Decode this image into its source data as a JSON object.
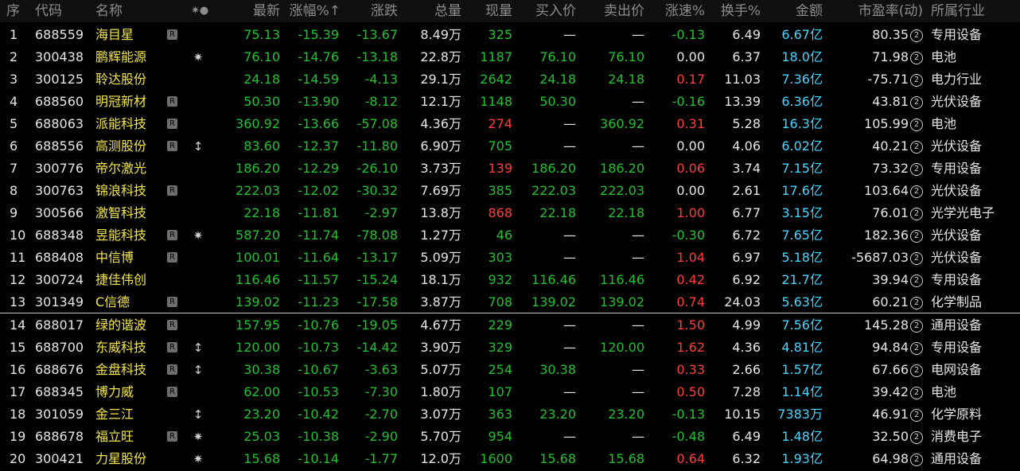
{
  "header": {
    "seq": "序",
    "code": "代码",
    "name": "名称",
    "icons": "✷●",
    "latest": "最新",
    "chg_pct": "涨幅%↑",
    "chg": "涨跌",
    "volume": "总量",
    "cur_vol": "现量",
    "bid": "买入价",
    "ask": "卖出价",
    "speed": "涨速%",
    "turnover": "换手%",
    "amount": "金额",
    "pe": "市盈率(动)",
    "industry": "所属行业"
  },
  "colors": {
    "up": "#ff3b3b",
    "down": "#20c030",
    "flat": "#e6e6e6",
    "name": "#f2e64a",
    "amount": "#45d6ff"
  },
  "rows": [
    {
      "seq": "1",
      "code": "688559",
      "name": "海目星",
      "badge": "R",
      "icon": "",
      "latest": "75.13",
      "chg_pct": "-15.39",
      "chg": "-13.67",
      "volume": "8.49万",
      "cur_vol": "325",
      "cur_dir": "down",
      "bid": "—",
      "ask": "—",
      "speed": "-0.13",
      "speed_dir": "down",
      "turnover": "6.49",
      "amount": "6.67",
      "amount_unit": "亿",
      "pe": "80.35",
      "pe_mark": "2",
      "industry": "专用设备"
    },
    {
      "seq": "2",
      "code": "300438",
      "name": "鹏辉能源",
      "badge": "",
      "icon": "✷",
      "latest": "76.10",
      "chg_pct": "-14.76",
      "chg": "-13.18",
      "volume": "22.8万",
      "cur_vol": "1187",
      "cur_dir": "down",
      "bid": "76.10",
      "ask": "76.10",
      "speed": "0.00",
      "speed_dir": "flat",
      "turnover": "6.37",
      "amount": "18.0",
      "amount_unit": "亿",
      "pe": "71.98",
      "pe_mark": "2",
      "industry": "电池"
    },
    {
      "seq": "3",
      "code": "300125",
      "name": "聆达股份",
      "badge": "",
      "icon": "",
      "latest": "24.18",
      "chg_pct": "-14.59",
      "chg": "-4.13",
      "volume": "29.1万",
      "cur_vol": "2642",
      "cur_dir": "down",
      "bid": "24.18",
      "ask": "24.18",
      "speed": "0.17",
      "speed_dir": "up",
      "turnover": "11.03",
      "amount": "7.36",
      "amount_unit": "亿",
      "pe": "-75.71",
      "pe_mark": "2",
      "industry": "电力行业"
    },
    {
      "seq": "4",
      "code": "688560",
      "name": "明冠新材",
      "badge": "R",
      "icon": "",
      "latest": "50.30",
      "chg_pct": "-13.90",
      "chg": "-8.12",
      "volume": "12.1万",
      "cur_vol": "1148",
      "cur_dir": "down",
      "bid": "50.30",
      "ask": "—",
      "speed": "-0.16",
      "speed_dir": "down",
      "turnover": "13.39",
      "amount": "6.36",
      "amount_unit": "亿",
      "pe": "43.81",
      "pe_mark": "2",
      "industry": "光伏设备"
    },
    {
      "seq": "5",
      "code": "688063",
      "name": "派能科技",
      "badge": "R",
      "icon": "",
      "latest": "360.92",
      "chg_pct": "-13.66",
      "chg": "-57.08",
      "volume": "4.36万",
      "cur_vol": "274",
      "cur_dir": "up",
      "bid": "—",
      "ask": "360.92",
      "speed": "0.31",
      "speed_dir": "up",
      "turnover": "5.28",
      "amount": "16.3",
      "amount_unit": "亿",
      "pe": "105.99",
      "pe_mark": "2",
      "industry": "电池"
    },
    {
      "seq": "6",
      "code": "688556",
      "name": "高测股份",
      "badge": "R",
      "icon": "↕",
      "latest": "83.60",
      "chg_pct": "-12.37",
      "chg": "-11.80",
      "volume": "6.90万",
      "cur_vol": "705",
      "cur_dir": "down",
      "bid": "—",
      "ask": "—",
      "speed": "0.00",
      "speed_dir": "flat",
      "turnover": "4.06",
      "amount": "6.02",
      "amount_unit": "亿",
      "pe": "40.21",
      "pe_mark": "2",
      "industry": "光伏设备"
    },
    {
      "seq": "7",
      "code": "300776",
      "name": "帝尔激光",
      "badge": "",
      "icon": "",
      "latest": "186.20",
      "chg_pct": "-12.29",
      "chg": "-26.10",
      "volume": "3.73万",
      "cur_vol": "139",
      "cur_dir": "up",
      "bid": "186.20",
      "ask": "186.20",
      "speed": "0.06",
      "speed_dir": "up",
      "turnover": "3.74",
      "amount": "7.15",
      "amount_unit": "亿",
      "pe": "73.32",
      "pe_mark": "2",
      "industry": "专用设备"
    },
    {
      "seq": "8",
      "code": "300763",
      "name": "锦浪科技",
      "badge": "R",
      "icon": "",
      "latest": "222.03",
      "chg_pct": "-12.02",
      "chg": "-30.32",
      "volume": "7.69万",
      "cur_vol": "385",
      "cur_dir": "down",
      "bid": "222.03",
      "ask": "222.03",
      "speed": "0.00",
      "speed_dir": "flat",
      "turnover": "2.61",
      "amount": "17.6",
      "amount_unit": "亿",
      "pe": "103.64",
      "pe_mark": "2",
      "industry": "光伏设备"
    },
    {
      "seq": "9",
      "code": "300566",
      "name": "激智科技",
      "badge": "",
      "icon": "",
      "latest": "22.18",
      "chg_pct": "-11.81",
      "chg": "-2.97",
      "volume": "13.8万",
      "cur_vol": "868",
      "cur_dir": "up",
      "bid": "22.18",
      "ask": "22.18",
      "speed": "1.00",
      "speed_dir": "up",
      "turnover": "6.77",
      "amount": "3.15",
      "amount_unit": "亿",
      "pe": "76.01",
      "pe_mark": "2",
      "industry": "光学光电子"
    },
    {
      "seq": "10",
      "code": "688348",
      "name": "昱能科技",
      "badge": "R",
      "icon": "✷",
      "latest": "587.20",
      "chg_pct": "-11.74",
      "chg": "-78.08",
      "volume": "1.27万",
      "cur_vol": "46",
      "cur_dir": "down",
      "bid": "—",
      "ask": "—",
      "speed": "-0.30",
      "speed_dir": "down",
      "turnover": "6.72",
      "amount": "7.65",
      "amount_unit": "亿",
      "pe": "182.36",
      "pe_mark": "2",
      "industry": "光伏设备"
    },
    {
      "seq": "11",
      "code": "688408",
      "name": "中信博",
      "badge": "R",
      "icon": "",
      "latest": "100.01",
      "chg_pct": "-11.64",
      "chg": "-13.17",
      "volume": "5.09万",
      "cur_vol": "303",
      "cur_dir": "down",
      "bid": "—",
      "ask": "—",
      "speed": "1.04",
      "speed_dir": "up",
      "turnover": "6.97",
      "amount": "5.18",
      "amount_unit": "亿",
      "pe": "-5687.03",
      "pe_mark": "2",
      "industry": "光伏设备"
    },
    {
      "seq": "12",
      "code": "300724",
      "name": "捷佳伟创",
      "badge": "",
      "icon": "",
      "latest": "116.46",
      "chg_pct": "-11.57",
      "chg": "-15.24",
      "volume": "18.1万",
      "cur_vol": "932",
      "cur_dir": "down",
      "bid": "116.46",
      "ask": "116.46",
      "speed": "0.42",
      "speed_dir": "up",
      "turnover": "6.92",
      "amount": "21.7",
      "amount_unit": "亿",
      "pe": "39.94",
      "pe_mark": "2",
      "industry": "专用设备"
    },
    {
      "seq": "13",
      "code": "301349",
      "name": "C信德",
      "badge": "R",
      "icon": "",
      "latest": "139.02",
      "chg_pct": "-11.23",
      "chg": "-17.58",
      "volume": "3.87万",
      "cur_vol": "708",
      "cur_dir": "down",
      "bid": "139.02",
      "ask": "139.02",
      "speed": "0.74",
      "speed_dir": "up",
      "turnover": "24.03",
      "amount": "5.63",
      "amount_unit": "亿",
      "pe": "60.21",
      "pe_mark": "2",
      "industry": "化学制品"
    },
    {
      "seq": "14",
      "code": "688017",
      "name": "绿的谐波",
      "badge": "R",
      "icon": "",
      "latest": "157.95",
      "chg_pct": "-10.76",
      "chg": "-19.05",
      "volume": "4.67万",
      "cur_vol": "229",
      "cur_dir": "down",
      "bid": "—",
      "ask": "—",
      "speed": "1.50",
      "speed_dir": "up",
      "turnover": "4.99",
      "amount": "7.56",
      "amount_unit": "亿",
      "pe": "145.28",
      "pe_mark": "2",
      "industry": "通用设备"
    },
    {
      "seq": "15",
      "code": "688700",
      "name": "东威科技",
      "badge": "R",
      "icon": "↕",
      "latest": "120.00",
      "chg_pct": "-10.73",
      "chg": "-14.42",
      "volume": "3.90万",
      "cur_vol": "329",
      "cur_dir": "down",
      "bid": "—",
      "ask": "120.00",
      "speed": "1.62",
      "speed_dir": "up",
      "turnover": "4.36",
      "amount": "4.81",
      "amount_unit": "亿",
      "pe": "94.84",
      "pe_mark": "2",
      "industry": "专用设备"
    },
    {
      "seq": "16",
      "code": "688676",
      "name": "金盘科技",
      "badge": "R",
      "icon": "↕",
      "latest": "30.38",
      "chg_pct": "-10.67",
      "chg": "-3.63",
      "volume": "5.07万",
      "cur_vol": "254",
      "cur_dir": "down",
      "bid": "30.38",
      "ask": "—",
      "speed": "0.33",
      "speed_dir": "up",
      "turnover": "2.66",
      "amount": "1.57",
      "amount_unit": "亿",
      "pe": "67.66",
      "pe_mark": "2",
      "industry": "电网设备"
    },
    {
      "seq": "17",
      "code": "688345",
      "name": "博力威",
      "badge": "R",
      "icon": "",
      "latest": "62.00",
      "chg_pct": "-10.53",
      "chg": "-7.30",
      "volume": "1.80万",
      "cur_vol": "107",
      "cur_dir": "down",
      "bid": "—",
      "ask": "—",
      "speed": "0.50",
      "speed_dir": "up",
      "turnover": "7.28",
      "amount": "1.14",
      "amount_unit": "亿",
      "pe": "39.42",
      "pe_mark": "2",
      "industry": "电池"
    },
    {
      "seq": "18",
      "code": "301059",
      "name": "金三江",
      "badge": "",
      "icon": "↕",
      "latest": "23.20",
      "chg_pct": "-10.42",
      "chg": "-2.70",
      "volume": "3.07万",
      "cur_vol": "363",
      "cur_dir": "down",
      "bid": "23.20",
      "ask": "23.20",
      "speed": "-0.13",
      "speed_dir": "down",
      "turnover": "10.15",
      "amount": "7383",
      "amount_unit": "万",
      "pe": "46.91",
      "pe_mark": "2",
      "industry": "化学原料"
    },
    {
      "seq": "19",
      "code": "688678",
      "name": "福立旺",
      "badge": "R",
      "icon": "✷",
      "latest": "25.03",
      "chg_pct": "-10.38",
      "chg": "-2.90",
      "volume": "5.70万",
      "cur_vol": "954",
      "cur_dir": "down",
      "bid": "—",
      "ask": "—",
      "speed": "-0.48",
      "speed_dir": "down",
      "turnover": "6.49",
      "amount": "1.48",
      "amount_unit": "亿",
      "pe": "32.50",
      "pe_mark": "2",
      "industry": "消费电子"
    },
    {
      "seq": "20",
      "code": "300421",
      "name": "力星股份",
      "badge": "",
      "icon": "✷",
      "latest": "15.68",
      "chg_pct": "-10.14",
      "chg": "-1.77",
      "volume": "12.0万",
      "cur_vol": "1600",
      "cur_dir": "down",
      "bid": "15.68",
      "ask": "15.68",
      "speed": "0.64",
      "speed_dir": "up",
      "turnover": "6.32",
      "amount": "1.93",
      "amount_unit": "亿",
      "pe": "64.98",
      "pe_mark": "2",
      "industry": "通用设备"
    }
  ]
}
